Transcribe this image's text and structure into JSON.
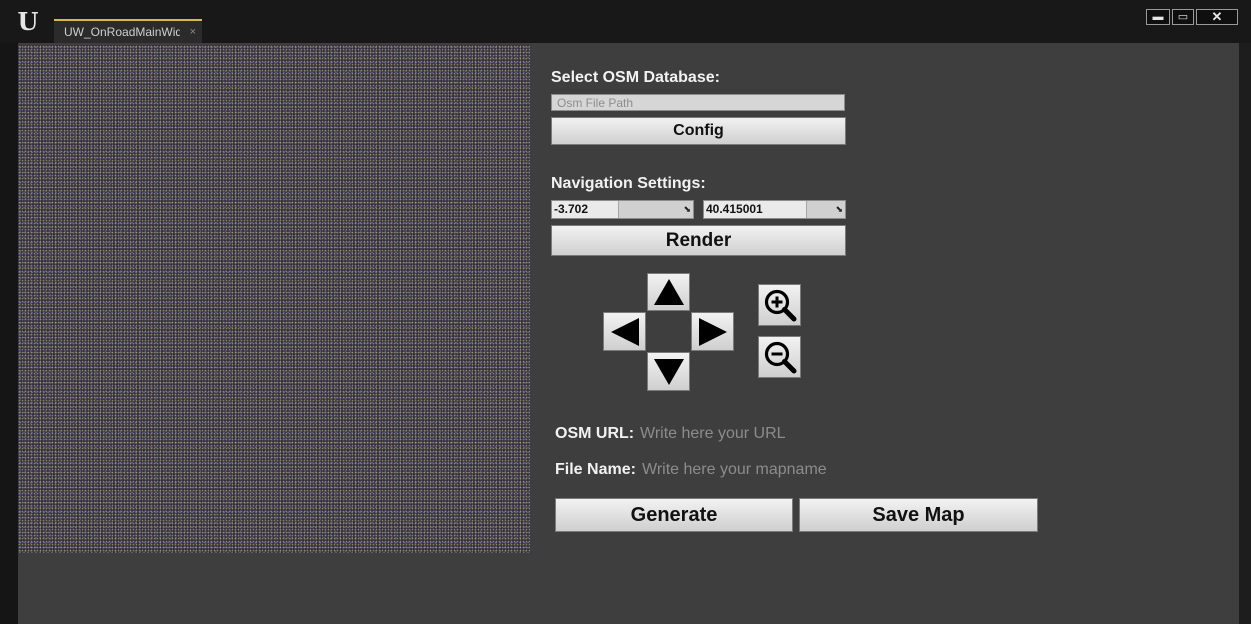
{
  "window": {
    "tab_label": "UW_OnRoadMainWidget",
    "tab_close": "×",
    "controls": {
      "minimize": "▬",
      "restore": "▭",
      "close": "✕"
    }
  },
  "osm": {
    "heading": "Select OSM Database:",
    "path_placeholder": "Osm File Path",
    "path_value": "",
    "config_label": "Config"
  },
  "navigation": {
    "heading": "Navigation Settings:",
    "longitude": {
      "value": "-3.702",
      "fill_fraction": 0.47
    },
    "latitude": {
      "value": "40.415001",
      "fill_fraction": 0.72
    },
    "render_label": "Render"
  },
  "controls": {
    "icons": [
      "arrow-up-icon",
      "arrow-left-icon",
      "arrow-right-icon",
      "arrow-down-icon",
      "zoom-in-icon",
      "zoom-out-icon"
    ]
  },
  "download": {
    "url_label": "OSM URL:",
    "url_placeholder": "Write here your URL",
    "url_value": "",
    "filename_label": "File Name:",
    "filename_placeholder": "Write here your mapname",
    "filename_value": "",
    "generate_label": "Generate",
    "save_label": "Save Map"
  }
}
